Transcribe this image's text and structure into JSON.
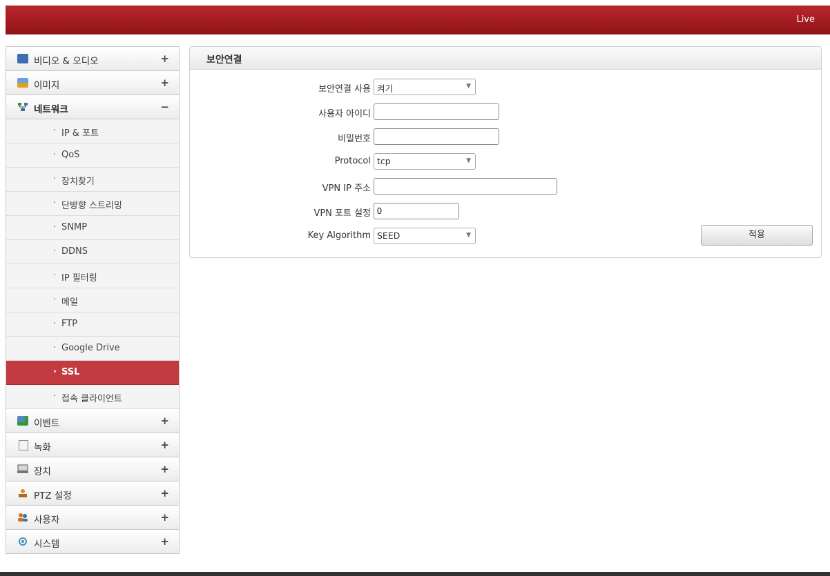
{
  "topbar": {
    "live_link": "Live"
  },
  "sidebar": {
    "top_items": [
      {
        "label": "비디오 & 오디오",
        "sign": "+",
        "icon": "video-audio-icon"
      },
      {
        "label": "이미지",
        "sign": "+",
        "icon": "image-icon"
      },
      {
        "label": "네트워크",
        "sign": "−",
        "icon": "network-icon"
      }
    ],
    "network_sub_items": [
      "IP & 포트",
      "QoS",
      "장치찾기",
      "단방향 스트리밍",
      "SNMP",
      "DDNS",
      "IP 필터링",
      "메일",
      "FTP",
      "Google Drive",
      "SSL",
      "접속 클라이언트"
    ],
    "active_sub_item": "SSL",
    "bottom_items": [
      {
        "label": "이벤트",
        "sign": "+",
        "icon": "event-icon"
      },
      {
        "label": "녹화",
        "sign": "+",
        "icon": "record-icon"
      },
      {
        "label": "장치",
        "sign": "+",
        "icon": "device-icon"
      },
      {
        "label": "PTZ 설정",
        "sign": "+",
        "icon": "ptz-icon"
      },
      {
        "label": "사용자",
        "sign": "+",
        "icon": "user-icon"
      },
      {
        "label": "시스템",
        "sign": "+",
        "icon": "system-icon"
      }
    ]
  },
  "panel": {
    "title": "보안연결",
    "fields": {
      "enable": {
        "label": "보안연결 사용",
        "value": "켜기"
      },
      "user_id": {
        "label": "사용자 아이디",
        "value": ""
      },
      "password": {
        "label": "비밀번호",
        "value": ""
      },
      "protocol": {
        "label": "Protocol",
        "value": "tcp"
      },
      "vpn_ip": {
        "label": "VPN IP 주소",
        "value": ""
      },
      "vpn_port": {
        "label": "VPN 포트 설정",
        "value": "0"
      },
      "key_algo": {
        "label": "Key Algorithm",
        "value": "SEED"
      }
    },
    "apply_label": "적용"
  },
  "colors": {
    "header_red": "#a31c20",
    "active_menu_red": "#c13b40"
  }
}
